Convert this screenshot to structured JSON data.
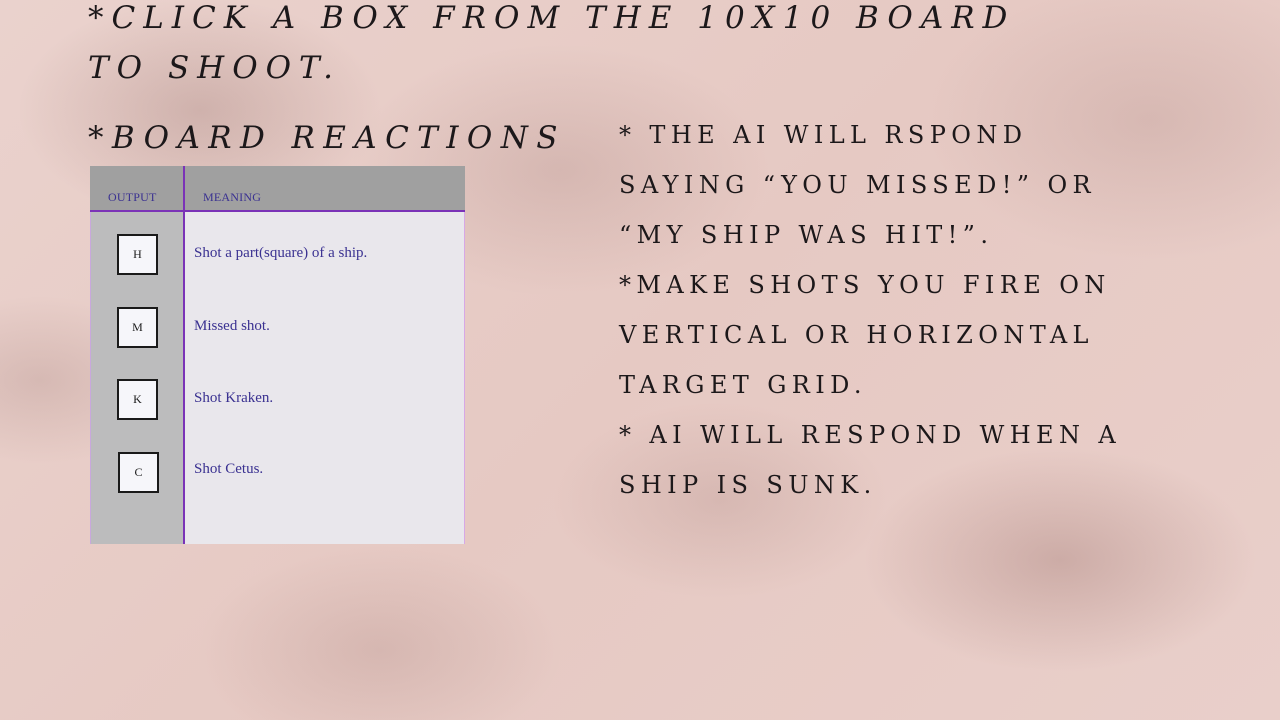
{
  "title": {
    "line1": "*click a box from the 10x10 board",
    "line2": "to shoot."
  },
  "reactions_heading": "*board reactions",
  "legend": {
    "headers": {
      "output": "OUTPUT",
      "meaning": "MEANING"
    },
    "rows": [
      {
        "code": "H",
        "meaning": "Shot a part(square) of a ship."
      },
      {
        "code": "M",
        "meaning": "Missed shot."
      },
      {
        "code": "K",
        "meaning": "Shot Kraken."
      },
      {
        "code": "C",
        "meaning": "Shot Cetus."
      }
    ]
  },
  "rules": [
    "* the AI will rspond",
    "saying “you missed!” or",
    "“my ship was hit!”.",
    "*make shots you fire on",
    "vertical or horizontal",
    "target grid.",
    "* AI will respond when a",
    "ship is sunk."
  ]
}
